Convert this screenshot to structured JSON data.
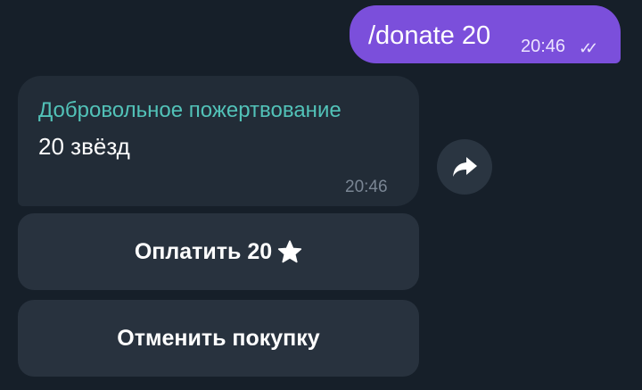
{
  "outgoing": {
    "text": "/donate 20",
    "time": "20:46",
    "status_icon": "double-check-icon"
  },
  "invoice": {
    "title": "Добровольное пожертвование",
    "body": "20 звёзд",
    "time": "20:46"
  },
  "buttons": {
    "pay": "Оплатить 20",
    "pay_icon": "star-icon",
    "cancel": "Отменить покупку"
  },
  "colors": {
    "outgoing_bubble": "#7b4fdb",
    "title": "#52c2b8",
    "background": "#161f29"
  }
}
